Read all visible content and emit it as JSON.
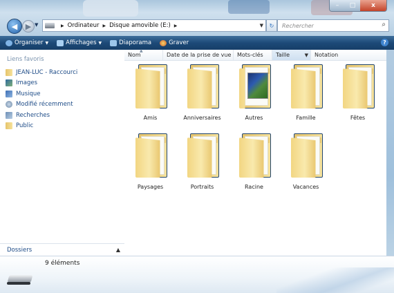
{
  "window": {
    "buttons": {
      "minimize": "–",
      "maximize": "□",
      "close": "x"
    }
  },
  "address": {
    "crumbs": [
      "Ordinateur",
      "Disque amovible (E:)"
    ],
    "search_placeholder": "Rechercher"
  },
  "toolbar": {
    "organize": "Organiser",
    "views": "Affichages",
    "slideshow": "Diaporama",
    "burn": "Graver"
  },
  "favorites": {
    "header": "Liens favoris",
    "items": [
      {
        "label": "JEAN-LUC - Raccourci",
        "icon": "folder-icon"
      },
      {
        "label": "Images",
        "icon": "pictures-icon"
      },
      {
        "label": "Musique",
        "icon": "music-icon"
      },
      {
        "label": "Modifié récemment",
        "icon": "recent-icon"
      },
      {
        "label": "Recherches",
        "icon": "search-folder-icon"
      },
      {
        "label": "Public",
        "icon": "folder-icon"
      }
    ],
    "folders_label": "Dossiers"
  },
  "columns": [
    "Nom",
    "Date de la prise de vue",
    "Mots-clés",
    "Taille",
    "Notation"
  ],
  "folders": [
    "Amis",
    "Anniversaires",
    "Autres",
    "Famille",
    "Fêtes",
    "Paysages",
    "Portraits",
    "Racine",
    "Vacances"
  ],
  "status": {
    "count": "9 éléments"
  },
  "colors": {
    "toolbar": "#1d4a78",
    "link": "#1c4a86",
    "folder": "#f2d682"
  }
}
